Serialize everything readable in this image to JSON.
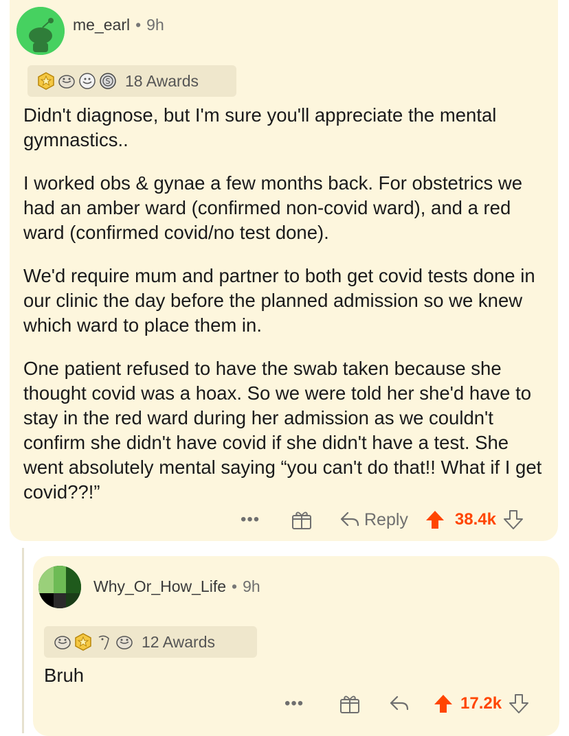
{
  "comment": {
    "username": "me_earl",
    "separator": "•",
    "time": "9h",
    "awards_label": "18 Awards",
    "paragraphs": [
      "Didn't diagnose, but I'm sure you'll appreciate the mental gymnastics..",
      "I worked obs & gynae a few months back. For obstetrics we had an amber ward (confirmed non-covid ward), and a red ward (confirmed covid/no test done).",
      "We'd require mum and partner to both get covid tests done in our clinic the day before the planned admission so we knew which ward to place them in.",
      "One patient refused to have the swab taken because she thought covid was a hoax. So we were told her she'd have to stay in the red ward during her admission as we couldn't confirm she didn't have covid if she didn't have a test. She went absolutely mental saying “you can't do that!! What if I get covid??!”"
    ],
    "more_label": "•••",
    "reply_label": "Reply",
    "score": "38.4k"
  },
  "reply": {
    "username": "Why_Or_How_Life",
    "separator": "•",
    "time": "9h",
    "awards_label": "12 Awards",
    "text": "Bruh",
    "more_label": "•••",
    "score": "17.2k"
  },
  "icons": {
    "award_1": "gold-award-icon",
    "award_2": "wholesome-award-icon",
    "award_3": "silver-award-icon",
    "award_4": "coin-award-icon",
    "gift": "gift-icon",
    "reply": "reply-arrow-icon",
    "upvote": "upvote-arrow-icon",
    "downvote": "downvote-arrow-icon"
  },
  "colors": {
    "card_background": "#fdf6dd",
    "upvote_orange": "#ff4500",
    "avatar_green": "#46d160",
    "muted_text": "#6f6f6f"
  }
}
